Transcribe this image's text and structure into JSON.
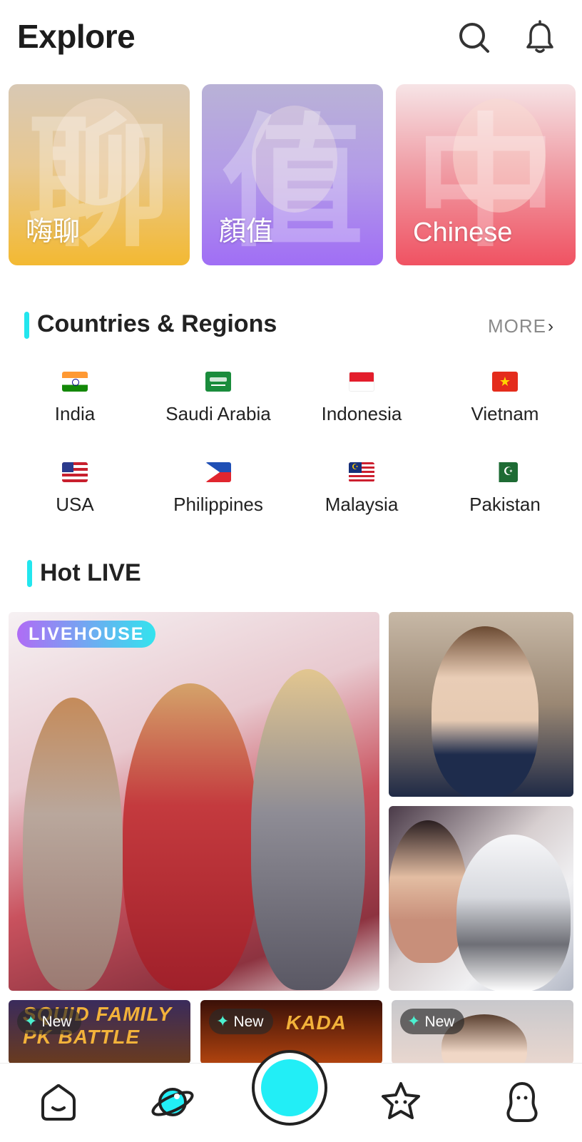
{
  "header": {
    "title": "Explore",
    "icons": [
      "search-icon",
      "bell-icon"
    ]
  },
  "categories": [
    {
      "label": "嗨聊",
      "bg_char": "聊"
    },
    {
      "label": "顏值",
      "bg_char": "值"
    },
    {
      "label": "Chinese",
      "bg_char": "中"
    }
  ],
  "countries_section": {
    "title": "Countries & Regions",
    "more_label": "MORE",
    "accent": "#22e6ee",
    "items": [
      {
        "name": "India"
      },
      {
        "name": "Saudi Arabia"
      },
      {
        "name": "Indonesia"
      },
      {
        "name": "Vietnam"
      },
      {
        "name": "USA"
      },
      {
        "name": "Philippines"
      },
      {
        "name": "Malaysia"
      },
      {
        "name": "Pakistan"
      }
    ]
  },
  "hot_live": {
    "title": "Hot LIVE",
    "badge": "LIVEHOUSE",
    "tiles_row2": [
      {
        "pill": "New",
        "overlay_text": "SQUID FAMILY PK BATTLE"
      },
      {
        "pill": "New",
        "overlay_text": "KADA"
      },
      {
        "pill": "New",
        "overlay_text": ""
      }
    ]
  },
  "tabbar": {
    "items": [
      "home-icon",
      "explore-planet-icon",
      "go-live-button",
      "favorites-star-icon",
      "profile-icon"
    ],
    "live_color": "#22eef6"
  }
}
